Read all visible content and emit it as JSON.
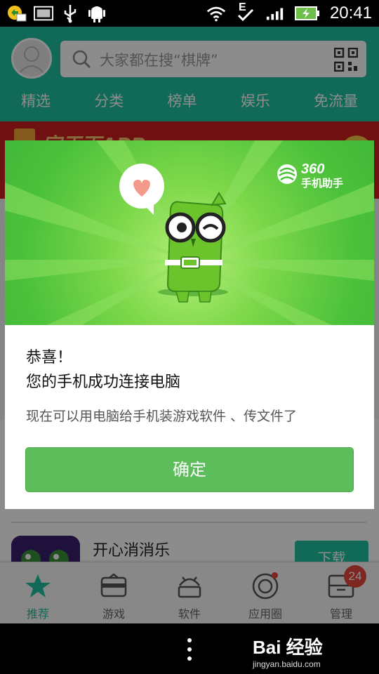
{
  "status_bar": {
    "time": "20:41",
    "network_letter": "E",
    "icons": [
      "notification-icon",
      "image-icon",
      "usb-icon",
      "android-debug-icon",
      "wifi-icon",
      "data-transfer-icon",
      "signal-icon",
      "battery-charging-icon"
    ]
  },
  "app": {
    "search_placeholder": "大家都在搜“棋牌”",
    "tabs": [
      "精选",
      "分类",
      "榜单",
      "娱乐",
      "免流量"
    ],
    "banner_text": "字天下APP",
    "list_item": {
      "name": "开心消消乐",
      "download_label": "下载"
    },
    "bottom_nav": [
      {
        "label": "推荐",
        "icon": "star-icon",
        "active": true
      },
      {
        "label": "游戏",
        "icon": "gamepad-icon",
        "active": false
      },
      {
        "label": "软件",
        "icon": "android-icon",
        "active": false
      },
      {
        "label": "应用圈",
        "icon": "camera-circle-icon",
        "active": false
      },
      {
        "label": "管理",
        "icon": "manage-icon",
        "active": false
      }
    ],
    "manage_badge": "24"
  },
  "dialog": {
    "brand_number": "360",
    "brand_name": "手机助手",
    "title_line1": "恭喜！",
    "title_line2": "您的手机成功连接电脑",
    "subtitle": "现在可以用电脑给手机装游戏软件 、传文件了",
    "confirm_label": "确定"
  },
  "watermark": {
    "main": "Bai 经验",
    "sub": "jingyan.baidu.com"
  },
  "colors": {
    "accent": "#1fbf9e",
    "confirm": "#5cbd5a",
    "hero_green": "#4bc13b",
    "badge": "#e8463c"
  }
}
